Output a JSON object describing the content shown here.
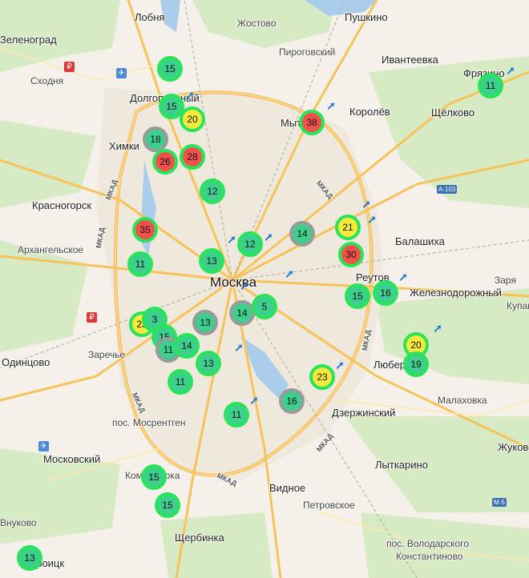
{
  "places": [
    {
      "name": "Лобня"
    },
    {
      "name": "Пушкино"
    },
    {
      "name": "Жостово"
    },
    {
      "name": "Пироговский"
    },
    {
      "name": "Ивантеевка"
    },
    {
      "name": "Фрязино"
    },
    {
      "name": "Сходня"
    },
    {
      "name": "Долгопрудный"
    },
    {
      "name": "Королёв"
    },
    {
      "name": "Щёлково"
    },
    {
      "name": "Химки"
    },
    {
      "name": "Мытищи"
    },
    {
      "name": "Красногорск"
    },
    {
      "name": "Архангельское"
    },
    {
      "name": "Балашиха"
    },
    {
      "name": "Реутов"
    },
    {
      "name": "Заря"
    },
    {
      "name": "Железнодорожный"
    },
    {
      "name": "Купавна"
    },
    {
      "name": "Москва"
    },
    {
      "name": "Заречье"
    },
    {
      "name": "Одинцово"
    },
    {
      "name": "Люберцы"
    },
    {
      "name": "Малаховка"
    },
    {
      "name": "Дзержинский"
    },
    {
      "name": "пос. Мосрентген"
    },
    {
      "name": "Московский"
    },
    {
      "name": "Жуковский"
    },
    {
      "name": "Лыткарино"
    },
    {
      "name": "Коммунарка"
    },
    {
      "name": "Видное"
    },
    {
      "name": "Петровское"
    },
    {
      "name": "Щербинка"
    },
    {
      "name": "Троицк"
    },
    {
      "name": "пос. Володарского"
    },
    {
      "name": "Константиново"
    },
    {
      "name": "Зеленоград"
    },
    {
      "name": "Внуково"
    }
  ],
  "road_labels": [
    "МКАД",
    "МКАД",
    "МКАД",
    "МКАД",
    "МКАД",
    "МКАД",
    "МКАД"
  ],
  "road_shields": [
    "A-103",
    "M-5"
  ],
  "markers": [
    {
      "value": "15",
      "color": "green"
    },
    {
      "value": "11",
      "color": "green"
    },
    {
      "value": "15",
      "color": "green"
    },
    {
      "value": "20",
      "color": "yellow"
    },
    {
      "value": "38",
      "color": "red"
    },
    {
      "value": "18",
      "color": "grey"
    },
    {
      "value": "26",
      "color": "red"
    },
    {
      "value": "28",
      "color": "red"
    },
    {
      "value": "12",
      "color": "green"
    },
    {
      "value": "35",
      "color": "red"
    },
    {
      "value": "14",
      "color": "grey"
    },
    {
      "value": "21",
      "color": "yellow"
    },
    {
      "value": "30",
      "color": "red"
    },
    {
      "value": "11",
      "color": "green"
    },
    {
      "value": "12",
      "color": "green"
    },
    {
      "value": "13",
      "color": "green"
    },
    {
      "value": "16",
      "color": "green"
    },
    {
      "value": "15",
      "color": "green"
    },
    {
      "value": "14",
      "color": "grey"
    },
    {
      "value": "5",
      "color": "green"
    },
    {
      "value": "23",
      "color": "yellow"
    },
    {
      "value": "13",
      "color": "grey"
    },
    {
      "value": "3",
      "color": "green"
    },
    {
      "value": "15",
      "color": "green"
    },
    {
      "value": "11",
      "color": "grey"
    },
    {
      "value": "14",
      "color": "green"
    },
    {
      "value": "13",
      "color": "green"
    },
    {
      "value": "20",
      "color": "yellow"
    },
    {
      "value": "19",
      "color": "green"
    },
    {
      "value": "11",
      "color": "green"
    },
    {
      "value": "23",
      "color": "yellow"
    },
    {
      "value": "16",
      "color": "grey"
    },
    {
      "value": "11",
      "color": "green"
    },
    {
      "value": "15",
      "color": "green"
    },
    {
      "value": "15",
      "color": "green"
    },
    {
      "value": "13",
      "color": "green"
    }
  ],
  "colors": {
    "green": "#3ccf8e",
    "yellow": "#f5ea3a",
    "red": "#f2514b",
    "ring": "#29e35a",
    "grey_ring": "#9a9a9a"
  }
}
